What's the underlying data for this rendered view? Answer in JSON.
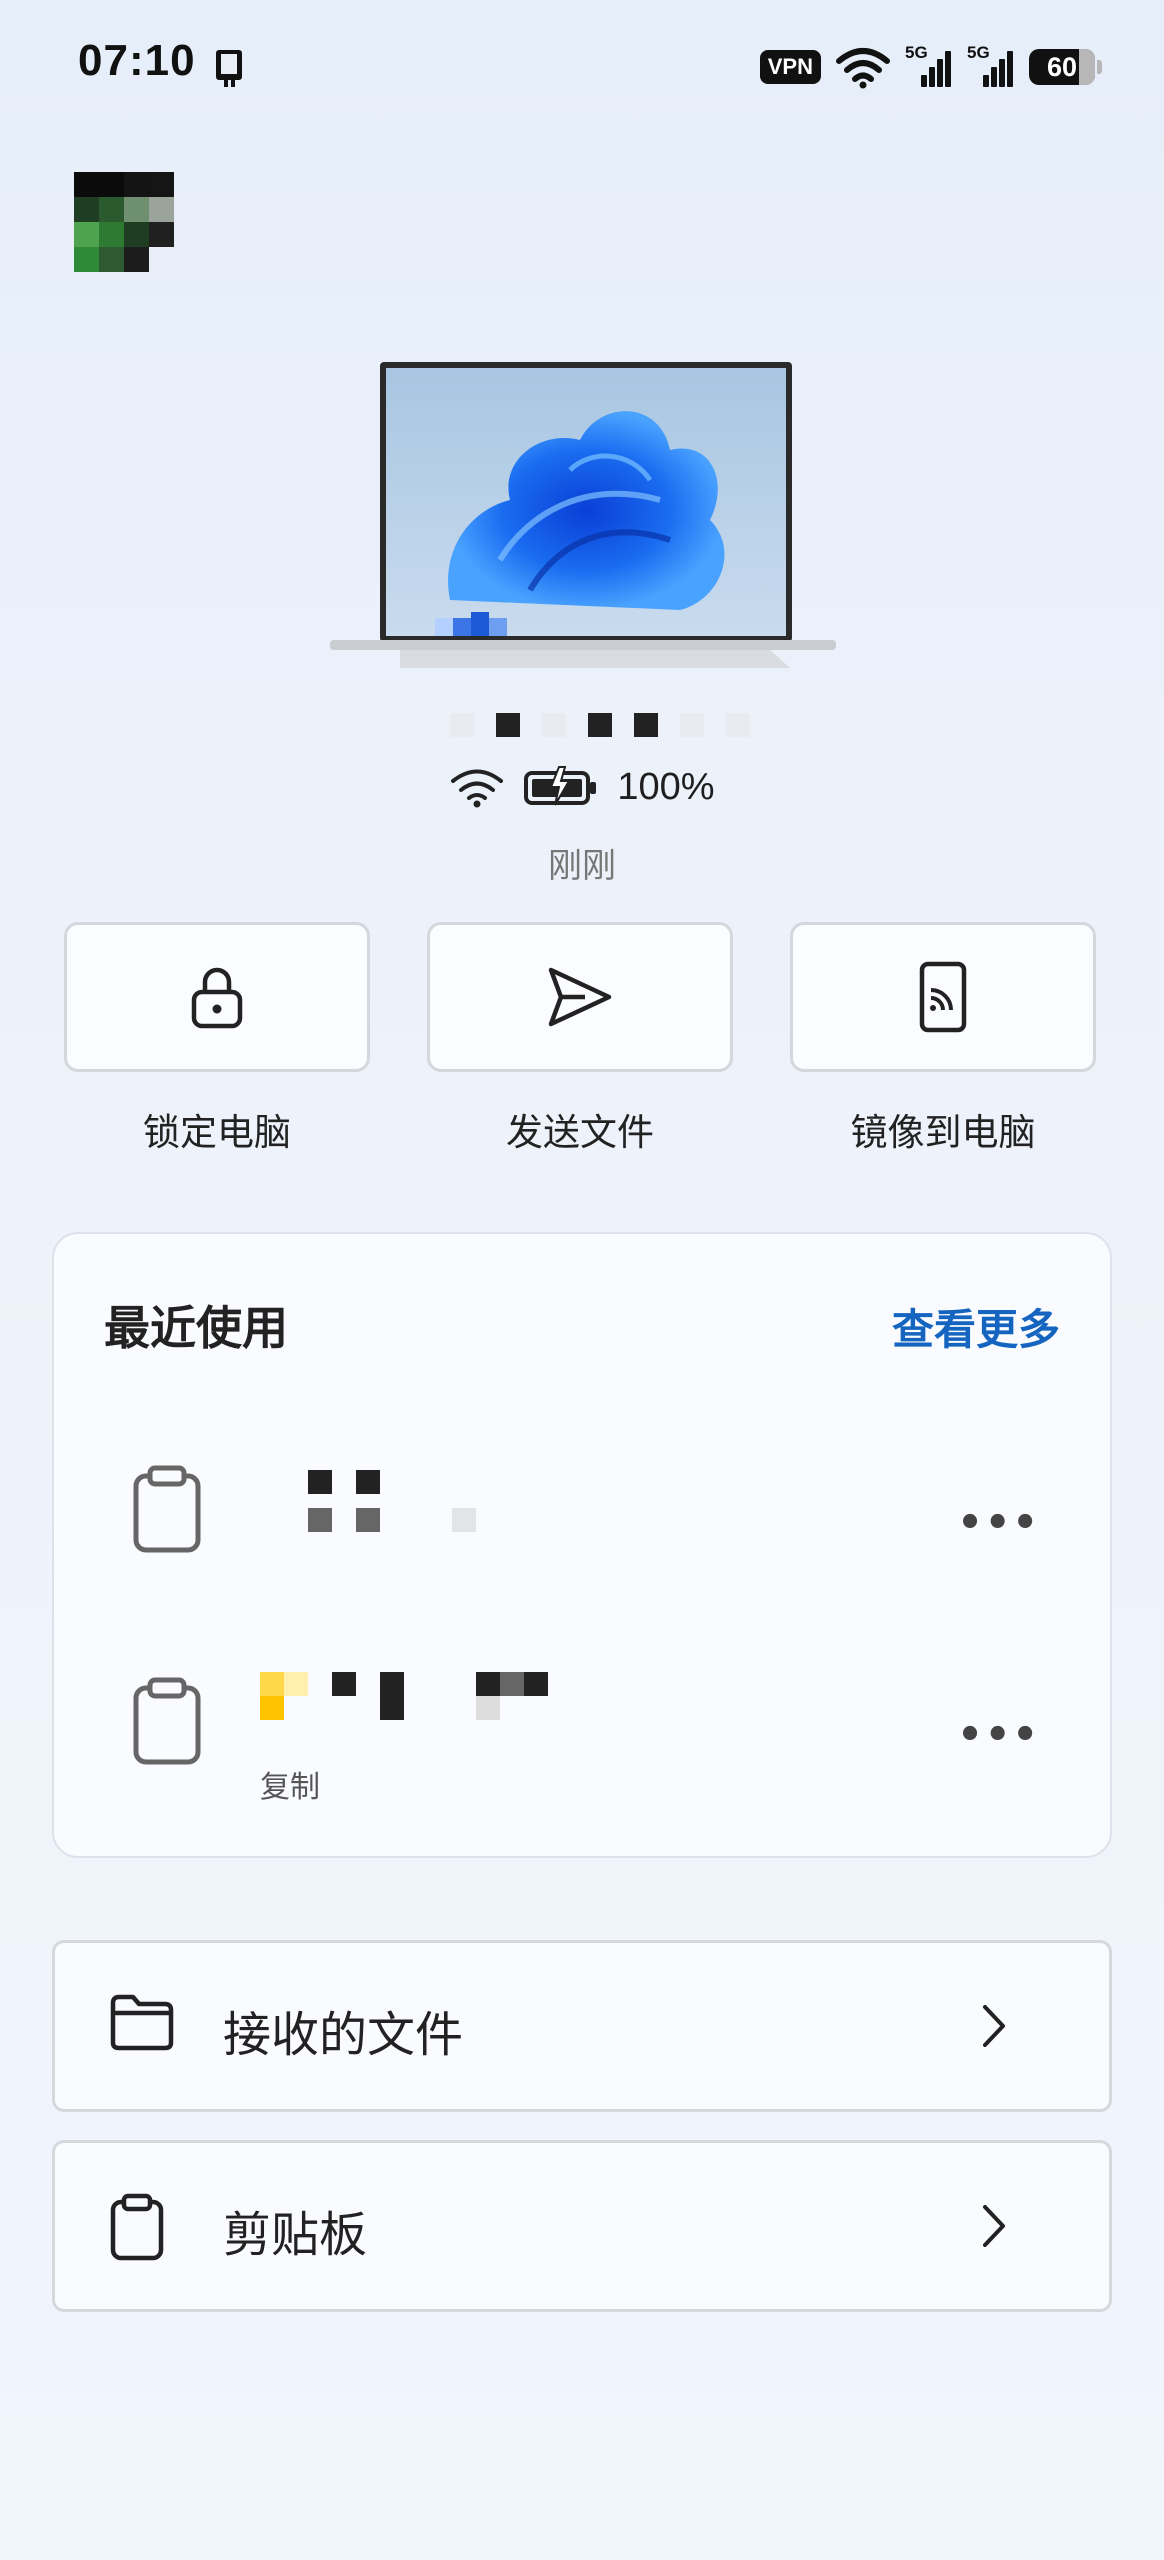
{
  "status_bar": {
    "time": "07:10",
    "vpn": "VPN",
    "sim1_tag": "5G",
    "sim2_tag": "5G",
    "battery": "60"
  },
  "device": {
    "battery_text": "100%",
    "last_seen": "刚刚"
  },
  "quick_actions": [
    {
      "label": "锁定电脑",
      "icon": "lock-icon"
    },
    {
      "label": "发送文件",
      "icon": "send-icon"
    },
    {
      "label": "镜像到电脑",
      "icon": "cast-icon"
    }
  ],
  "recent": {
    "title": "最近使用",
    "see_more": "查看更多",
    "items": [
      {
        "icon": "clipboard-icon",
        "more": "•••",
        "subtitle": ""
      },
      {
        "icon": "clipboard-icon",
        "more": "•••",
        "subtitle": "复制"
      }
    ]
  },
  "nav": {
    "received_files": "接收的文件",
    "clipboard": "剪贴板"
  },
  "colors": {
    "accent": "#1565c0",
    "background": "#edf2fa"
  }
}
